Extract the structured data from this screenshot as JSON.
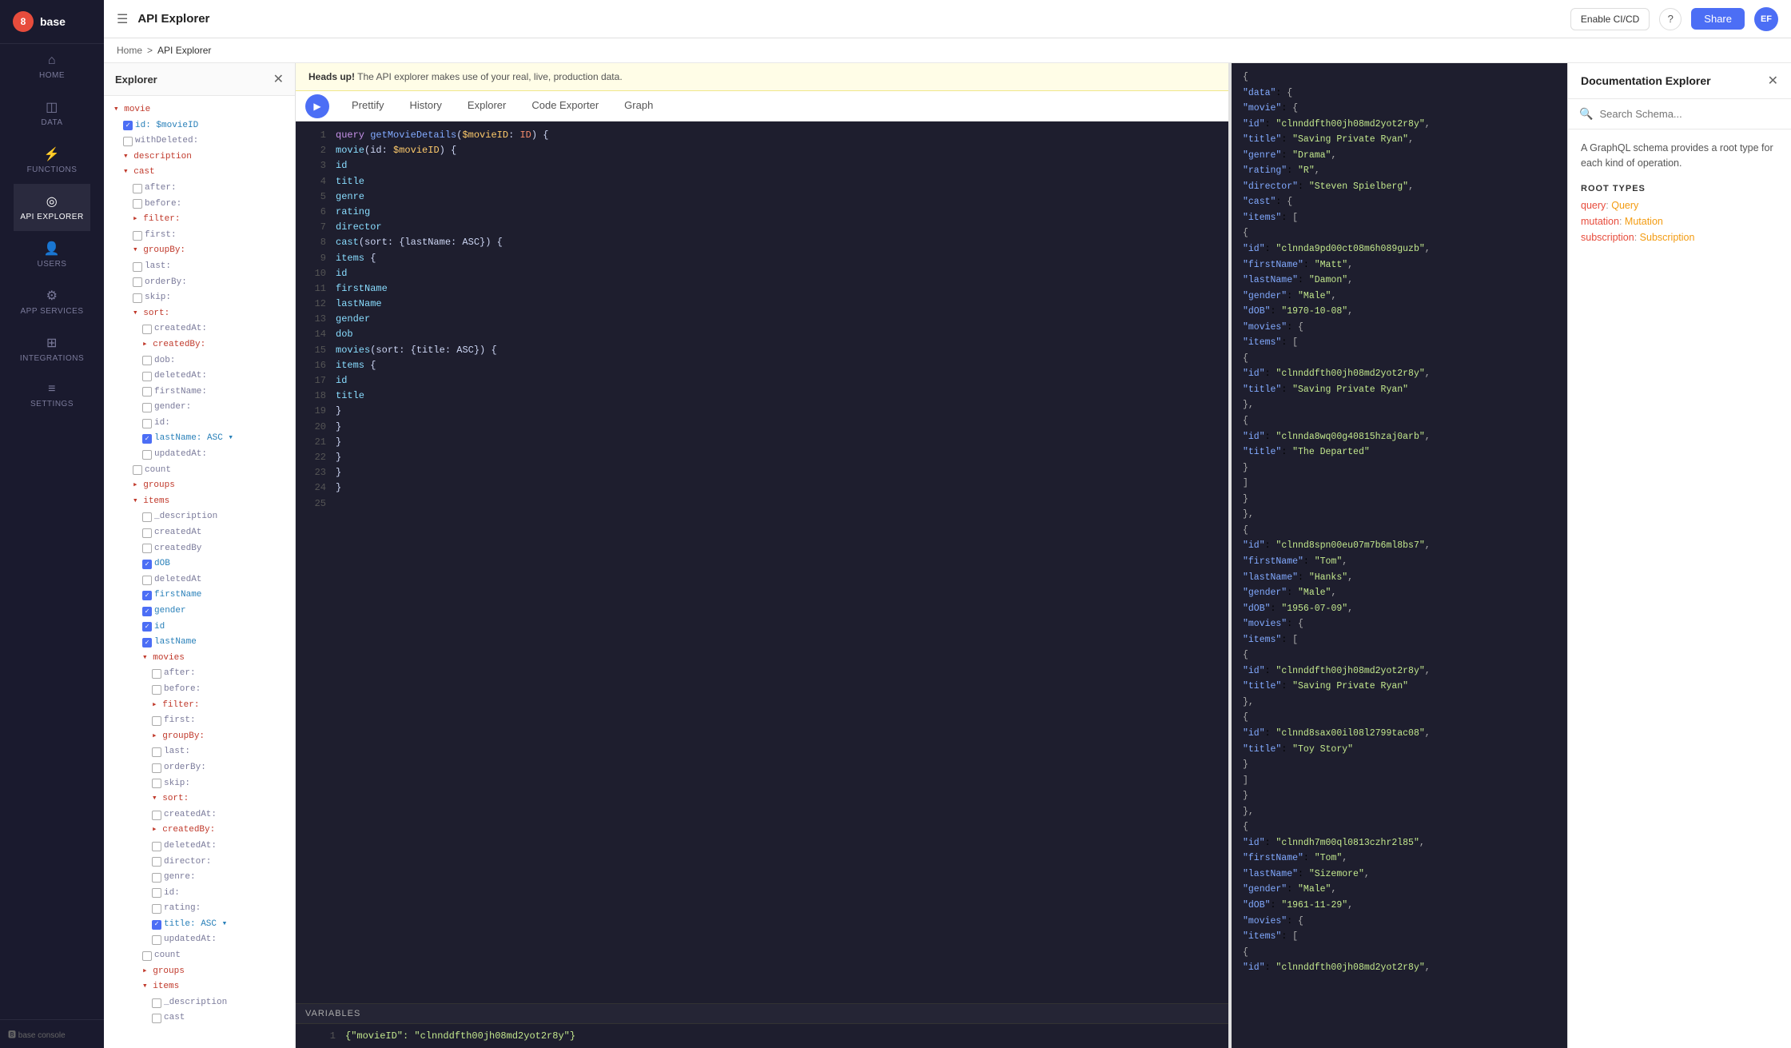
{
  "app": {
    "name": "8base",
    "logo_text": "base",
    "logo_initial": "8"
  },
  "topbar": {
    "menu_icon": "☰",
    "title": "API Explorer",
    "enable_ci_cd": "Enable CI/CD",
    "help": "?",
    "share": "Share",
    "avatar": "EF"
  },
  "breadcrumb": {
    "home": "Home",
    "sep": ">",
    "current": "API Explorer"
  },
  "explorer": {
    "title": "Explorer",
    "close_icon": "✕",
    "tree": [
      {
        "indent": 0,
        "type": "section",
        "label": "▾ movie"
      },
      {
        "indent": 1,
        "type": "check",
        "checked": true,
        "label": "id: $movieID"
      },
      {
        "indent": 1,
        "type": "check",
        "checked": false,
        "label": "withDeleted:"
      },
      {
        "indent": 1,
        "type": "section",
        "label": "▾ description"
      },
      {
        "indent": 1,
        "type": "section",
        "label": "▾ cast"
      },
      {
        "indent": 2,
        "type": "check",
        "checked": false,
        "label": "after:"
      },
      {
        "indent": 2,
        "type": "check",
        "checked": false,
        "label": "before:"
      },
      {
        "indent": 2,
        "type": "section",
        "label": "▸ filter:"
      },
      {
        "indent": 2,
        "type": "check",
        "checked": false,
        "label": "first:"
      },
      {
        "indent": 2,
        "type": "section",
        "label": "▾ groupBy:"
      },
      {
        "indent": 2,
        "type": "check",
        "checked": false,
        "label": "last:"
      },
      {
        "indent": 2,
        "type": "check",
        "checked": false,
        "label": "orderBy:"
      },
      {
        "indent": 2,
        "type": "check",
        "checked": false,
        "label": "skip:"
      },
      {
        "indent": 2,
        "type": "section",
        "label": "▾ sort:"
      },
      {
        "indent": 3,
        "type": "check",
        "checked": false,
        "label": "createdAt:"
      },
      {
        "indent": 3,
        "type": "section",
        "label": "▸ createdBy:"
      },
      {
        "indent": 3,
        "type": "check",
        "checked": false,
        "label": "dob:"
      },
      {
        "indent": 3,
        "type": "check",
        "checked": false,
        "label": "deletedAt:"
      },
      {
        "indent": 3,
        "type": "check",
        "checked": false,
        "label": "firstName:"
      },
      {
        "indent": 3,
        "type": "check",
        "checked": false,
        "label": "gender:"
      },
      {
        "indent": 3,
        "type": "check",
        "checked": false,
        "label": "id:"
      },
      {
        "indent": 3,
        "type": "check",
        "checked": true,
        "label": "lastName: ASC ▾"
      },
      {
        "indent": 3,
        "type": "check",
        "checked": false,
        "label": "updatedAt:"
      },
      {
        "indent": 2,
        "type": "check",
        "checked": false,
        "label": "count"
      },
      {
        "indent": 2,
        "type": "section",
        "label": "▸ groups"
      },
      {
        "indent": 2,
        "type": "section",
        "label": "▾ items"
      },
      {
        "indent": 3,
        "type": "check",
        "checked": false,
        "label": "_description"
      },
      {
        "indent": 3,
        "type": "check",
        "checked": false,
        "label": "createdAt"
      },
      {
        "indent": 3,
        "type": "check",
        "checked": false,
        "label": "createdBy"
      },
      {
        "indent": 3,
        "type": "check",
        "checked": true,
        "label": "dOB"
      },
      {
        "indent": 3,
        "type": "check",
        "checked": false,
        "label": "deletedAt"
      },
      {
        "indent": 3,
        "type": "check",
        "checked": true,
        "label": "firstName"
      },
      {
        "indent": 3,
        "type": "check",
        "checked": true,
        "label": "gender"
      },
      {
        "indent": 3,
        "type": "check",
        "checked": true,
        "label": "id"
      },
      {
        "indent": 3,
        "type": "check",
        "checked": true,
        "label": "lastName"
      },
      {
        "indent": 3,
        "type": "section",
        "label": "▾ movies"
      },
      {
        "indent": 4,
        "type": "check",
        "checked": false,
        "label": "after:"
      },
      {
        "indent": 4,
        "type": "check",
        "checked": false,
        "label": "before:"
      },
      {
        "indent": 4,
        "type": "section",
        "label": "▸ filter:"
      },
      {
        "indent": 4,
        "type": "check",
        "checked": false,
        "label": "first:"
      },
      {
        "indent": 4,
        "type": "section",
        "label": "▸ groupBy:"
      },
      {
        "indent": 4,
        "type": "check",
        "checked": false,
        "label": "last:"
      },
      {
        "indent": 4,
        "type": "check",
        "checked": false,
        "label": "orderBy:"
      },
      {
        "indent": 4,
        "type": "check",
        "checked": false,
        "label": "skip:"
      },
      {
        "indent": 4,
        "type": "section",
        "label": "▾ sort:"
      },
      {
        "indent": 4,
        "type": "check",
        "checked": false,
        "label": "createdAt:"
      },
      {
        "indent": 4,
        "type": "section",
        "label": "▸ createdBy:"
      },
      {
        "indent": 4,
        "type": "check",
        "checked": false,
        "label": "deletedAt:"
      },
      {
        "indent": 4,
        "type": "check",
        "checked": false,
        "label": "director:"
      },
      {
        "indent": 4,
        "type": "check",
        "checked": false,
        "label": "genre:"
      },
      {
        "indent": 4,
        "type": "check",
        "checked": false,
        "label": "id:"
      },
      {
        "indent": 4,
        "type": "check",
        "checked": false,
        "label": "rating:"
      },
      {
        "indent": 4,
        "type": "check",
        "checked": true,
        "label": "title: ASC ▾"
      },
      {
        "indent": 4,
        "type": "check",
        "checked": false,
        "label": "updatedAt:"
      },
      {
        "indent": 3,
        "type": "check",
        "checked": false,
        "label": "count"
      },
      {
        "indent": 3,
        "type": "section",
        "label": "▸ groups"
      },
      {
        "indent": 3,
        "type": "section",
        "label": "▾ items"
      },
      {
        "indent": 4,
        "type": "check",
        "checked": false,
        "label": "_description"
      },
      {
        "indent": 4,
        "type": "check",
        "checked": false,
        "label": "cast"
      }
    ]
  },
  "tabs": {
    "play_icon": "▶",
    "items": [
      {
        "label": "Prettify",
        "active": false
      },
      {
        "label": "History",
        "active": false
      },
      {
        "label": "Explorer",
        "active": false
      },
      {
        "label": "Code Exporter",
        "active": false
      },
      {
        "label": "Graph",
        "active": false
      }
    ]
  },
  "warning": {
    "prefix": "Heads up!",
    "text": " The API explorer makes use of your real, live, production data."
  },
  "code_editor": {
    "lines": [
      {
        "num": 1,
        "content": "query getMovieDetails($movieID: ID) {",
        "tokens": [
          {
            "t": "kw",
            "v": "query"
          },
          {
            "t": "plain",
            "v": " "
          },
          {
            "t": "fn",
            "v": "getMovieDetails"
          },
          {
            "t": "plain",
            "v": "("
          },
          {
            "t": "param",
            "v": "$movieID"
          },
          {
            "t": "plain",
            "v": ": "
          },
          {
            "t": "type",
            "v": "ID"
          },
          {
            "t": "plain",
            "v": ") {"
          }
        ]
      },
      {
        "num": 2,
        "content": "  movie(id: $movieID) {",
        "tokens": [
          {
            "t": "plain",
            "v": "  "
          },
          {
            "t": "field",
            "v": "movie"
          },
          {
            "t": "plain",
            "v": "(id: "
          },
          {
            "t": "param",
            "v": "$movieID"
          },
          {
            "t": "plain",
            "v": ") {"
          }
        ]
      },
      {
        "num": 3,
        "content": "    id",
        "tokens": [
          {
            "t": "plain",
            "v": "    "
          },
          {
            "t": "field",
            "v": "id"
          }
        ]
      },
      {
        "num": 4,
        "content": "    title",
        "tokens": [
          {
            "t": "plain",
            "v": "    "
          },
          {
            "t": "field",
            "v": "title"
          }
        ]
      },
      {
        "num": 5,
        "content": "    genre",
        "tokens": [
          {
            "t": "plain",
            "v": "    "
          },
          {
            "t": "field",
            "v": "genre"
          }
        ]
      },
      {
        "num": 6,
        "content": "    rating",
        "tokens": [
          {
            "t": "plain",
            "v": "    "
          },
          {
            "t": "field",
            "v": "rating"
          }
        ]
      },
      {
        "num": 7,
        "content": "    director",
        "tokens": [
          {
            "t": "plain",
            "v": "    "
          },
          {
            "t": "field",
            "v": "director"
          }
        ]
      },
      {
        "num": 8,
        "content": "    cast(sort: {lastName: ASC}) {",
        "tokens": [
          {
            "t": "plain",
            "v": "    "
          },
          {
            "t": "field",
            "v": "cast"
          },
          {
            "t": "plain",
            "v": "(sort: {lastName: ASC}) {"
          }
        ]
      },
      {
        "num": 9,
        "content": "      items {",
        "tokens": [
          {
            "t": "plain",
            "v": "      "
          },
          {
            "t": "field",
            "v": "items"
          },
          {
            "t": "plain",
            "v": " {"
          }
        ]
      },
      {
        "num": 10,
        "content": "        id",
        "tokens": [
          {
            "t": "plain",
            "v": "        "
          },
          {
            "t": "field",
            "v": "id"
          }
        ]
      },
      {
        "num": 11,
        "content": "        firstName",
        "tokens": [
          {
            "t": "plain",
            "v": "        "
          },
          {
            "t": "field",
            "v": "firstName"
          }
        ]
      },
      {
        "num": 12,
        "content": "        lastName",
        "tokens": [
          {
            "t": "plain",
            "v": "        "
          },
          {
            "t": "field",
            "v": "lastName"
          }
        ]
      },
      {
        "num": 13,
        "content": "        gender",
        "tokens": [
          {
            "t": "plain",
            "v": "        "
          },
          {
            "t": "field",
            "v": "gender"
          }
        ]
      },
      {
        "num": 14,
        "content": "        dob",
        "tokens": [
          {
            "t": "plain",
            "v": "        "
          },
          {
            "t": "field",
            "v": "dob"
          }
        ]
      },
      {
        "num": 15,
        "content": "        movies(sort: {title: ASC}) {",
        "tokens": [
          {
            "t": "plain",
            "v": "        "
          },
          {
            "t": "field",
            "v": "movies"
          },
          {
            "t": "plain",
            "v": "(sort: {title: ASC}) {"
          }
        ]
      },
      {
        "num": 16,
        "content": "          items {",
        "tokens": [
          {
            "t": "plain",
            "v": "          "
          },
          {
            "t": "field",
            "v": "items"
          },
          {
            "t": "plain",
            "v": " {"
          }
        ]
      },
      {
        "num": 17,
        "content": "            id",
        "tokens": [
          {
            "t": "plain",
            "v": "            "
          },
          {
            "t": "field",
            "v": "id"
          }
        ]
      },
      {
        "num": 18,
        "content": "            title",
        "tokens": [
          {
            "t": "plain",
            "v": "            "
          },
          {
            "t": "field",
            "v": "title"
          }
        ]
      },
      {
        "num": 19,
        "content": "          }",
        "tokens": [
          {
            "t": "plain",
            "v": "          }"
          }
        ]
      },
      {
        "num": 20,
        "content": "        }",
        "tokens": [
          {
            "t": "plain",
            "v": "        }"
          }
        ]
      },
      {
        "num": 21,
        "content": "      }",
        "tokens": [
          {
            "t": "plain",
            "v": "      }"
          }
        ]
      },
      {
        "num": 22,
        "content": "    }",
        "tokens": [
          {
            "t": "plain",
            "v": "    }"
          }
        ]
      },
      {
        "num": 23,
        "content": "  }",
        "tokens": [
          {
            "t": "plain",
            "v": "  }"
          }
        ]
      },
      {
        "num": 24,
        "content": "}",
        "tokens": [
          {
            "t": "plain",
            "v": "}"
          }
        ]
      },
      {
        "num": 25,
        "content": "",
        "tokens": []
      }
    ]
  },
  "variables": {
    "header": "VARIABLES",
    "line1": "{\"movieID\": \"clnnddfth00jh08md2yot2r8y\"}"
  },
  "results": {
    "lines": [
      "{",
      "  \"data\": {",
      "    \"movie\": {",
      "      \"id\": \"clnnddfth00jh08md2yot2r8y\",",
      "      \"title\": \"Saving Private Ryan\",",
      "      \"genre\": \"Drama\",",
      "      \"rating\": \"R\",",
      "      \"director\": \"Steven Spielberg\",",
      "      \"cast\": {",
      "        \"items\": [",
      "          {",
      "            \"id\": \"clnnda9pd00ct08m6h089guzb\",",
      "            \"firstName\": \"Matt\",",
      "            \"lastName\": \"Damon\",",
      "            \"gender\": \"Male\",",
      "            \"dOB\": \"1970-10-08\",",
      "            \"movies\": {",
      "              \"items\": [",
      "                {",
      "                  \"id\": \"clnnddfth00jh08md2yot2r8y\",",
      "                  \"title\": \"Saving Private Ryan\"",
      "                },",
      "                {",
      "                  \"id\": \"clnnda8wq00g40815hzaj0arb\",",
      "                  \"title\": \"The Departed\"",
      "                }",
      "              ]",
      "            }",
      "          },",
      "          {",
      "            \"id\": \"clnnd8spn00eu07m7b6ml8bs7\",",
      "            \"firstName\": \"Tom\",",
      "            \"lastName\": \"Hanks\",",
      "            \"gender\": \"Male\",",
      "            \"dOB\": \"1956-07-09\",",
      "            \"movies\": {",
      "              \"items\": [",
      "                {",
      "                  \"id\": \"clnnddfth00jh08md2yot2r8y\",",
      "                  \"title\": \"Saving Private Ryan\"",
      "                },",
      "                {",
      "                  \"id\": \"clnnd8sax00il08l2799tac08\",",
      "                  \"title\": \"Toy Story\"",
      "                }",
      "              ]",
      "            }",
      "          },",
      "          {",
      "            \"id\": \"clnndh7m00ql0813czhr2l85\",",
      "            \"firstName\": \"Tom\",",
      "            \"lastName\": \"Sizemore\",",
      "            \"gender\": \"Male\",",
      "            \"dOB\": \"1961-11-29\",",
      "            \"movies\": {",
      "              \"items\": [",
      "                {",
      "                  \"id\": \"clnnddfth00jh08md2yot2r8y\","
    ]
  },
  "doc_explorer": {
    "title": "Documentation Explorer",
    "close_icon": "✕",
    "search_placeholder": "Search Schema...",
    "description": "A GraphQL schema provides a root type for each kind of operation.",
    "root_types_label": "ROOT TYPES",
    "root_types": [
      {
        "prefix": "query",
        "sep": ": ",
        "value": "Query"
      },
      {
        "prefix": "mutation",
        "sep": ": ",
        "value": "Mutation"
      },
      {
        "prefix": "subscription",
        "sep": ": ",
        "value": "Subscription"
      }
    ]
  },
  "nav": [
    {
      "label": "HOME",
      "icon": "⌂",
      "active": false
    },
    {
      "label": "DATA",
      "icon": "◫",
      "active": false
    },
    {
      "label": "FUNCTIONS",
      "icon": "⚡",
      "active": false
    },
    {
      "label": "API EXPLORER",
      "icon": "◎",
      "active": true
    },
    {
      "label": "USERS",
      "icon": "👤",
      "active": false
    },
    {
      "label": "APP SERVICES",
      "icon": "⚙",
      "active": false
    },
    {
      "label": "INTEGRATIONS",
      "icon": "⊞",
      "active": false
    },
    {
      "label": "SETTINGS",
      "icon": "≡",
      "active": false
    }
  ]
}
